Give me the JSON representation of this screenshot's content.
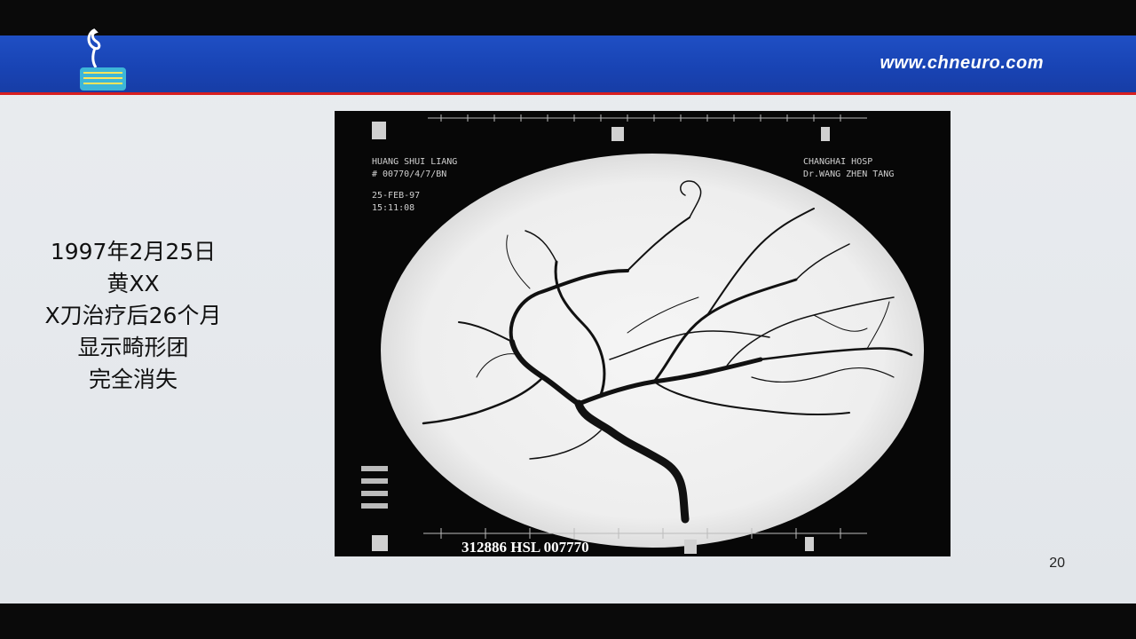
{
  "header": {
    "site_url": "www.chneuro.com",
    "logo_icon": "neuro-seahorse-logo"
  },
  "caption": {
    "lines": [
      "1997年2月25日",
      "黄XX",
      "X刀治疗后26个月",
      "显示畸形团",
      "完全消失"
    ]
  },
  "angiogram": {
    "film_id": "312886 HSL 007770",
    "top_left_lines": [
      "HUANG SHUI LIANG",
      "# 00770/4/7/BN",
      "25-FEB-97",
      "15:11:08"
    ],
    "top_right_lines": [
      "CHANGHAI HOSP",
      "Dr.WANG ZHEN TANG"
    ]
  },
  "page": {
    "number": "20"
  },
  "colors": {
    "banner_blue": "#1a46b8",
    "banner_red_line": "#d71f1f",
    "slide_bg": "#e8ebee"
  }
}
